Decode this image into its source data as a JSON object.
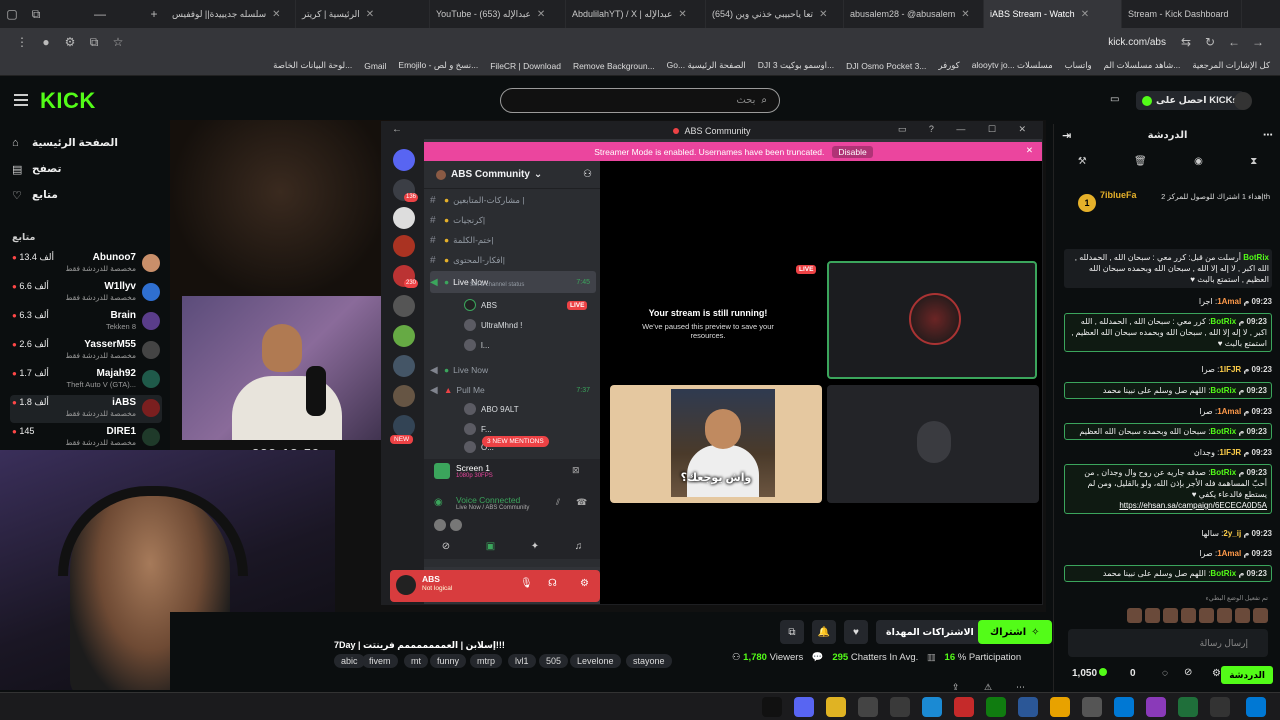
{
  "browser": {
    "tabs": [
      {
        "label": "سلسله جديييدة|| لوففيس"
      },
      {
        "label": "الرئيسية | كريتر"
      },
      {
        "label": "YouTube - عبدالإله (653)"
      },
      {
        "label": "AbdulilahYT) / X | عبدالإله"
      },
      {
        "label": "(654) تعا ياحبيبي خذني وين"
      },
      {
        "label": "abusalem28 - @abusalem"
      },
      {
        "label": "iABS Stream - Watch"
      },
      {
        "label": "Stream - Kick Dashboard"
      }
    ],
    "url": "kick.com/abs",
    "bookmarks": [
      "كل الإشارات المرجعية",
      "شاهد مسلسلات الم...",
      "واتساب",
      "alooytv jo... مسلسلات",
      "كورفر",
      "DJI Osmo Pocket 3...",
      "DJI اوسمو بوكيت 3...",
      "Go... الصفحة الرئيسية",
      "Remove Backgroun...",
      "FileCR | Download",
      "Emojilo - نسخ و لص...",
      "Gmail",
      "لوحة البيانات الخاصة..."
    ]
  },
  "kick": {
    "logo": "KICK",
    "search_placeholder": "بحث",
    "get_kicks": "احصل على KICKs"
  },
  "sidebar": {
    "nav": [
      {
        "label": "الصفحة الرئيسية",
        "icon": "home-icon",
        "glyph": "⌂"
      },
      {
        "label": "تصفح",
        "icon": "browse-icon",
        "glyph": "▤"
      },
      {
        "label": "متابع",
        "icon": "heart-icon",
        "glyph": "♡"
      }
    ],
    "following_title": "متابع",
    "streamers": [
      {
        "name": "Abunoo7",
        "count": "13.4 ألف",
        "category": "مخصصة للدردشة فقط"
      },
      {
        "name": "W1llyv",
        "count": "6.6 ألف",
        "category": "مخصصة للدردشة فقط"
      },
      {
        "name": "Brain",
        "count": "6.3 ألف",
        "category": "Tekken 8"
      },
      {
        "name": "YasserM55",
        "count": "2.6 ألف",
        "category": "مخصصة للدردشة فقط"
      },
      {
        "name": "Majah92",
        "count": "1.7 ألف",
        "category": "Theft Auto V (GTA)..."
      },
      {
        "name": "iABS",
        "count": "1.8 ألف",
        "category": "مخصصة للدردشة فقط"
      },
      {
        "name": "DIRE1",
        "count": "145",
        "category": "مخصصة للدردشة فقط"
      }
    ]
  },
  "stream": {
    "timer": "222:18:59",
    "discord": {
      "window_title": "ABS Community",
      "streamer_mode": "Streamer Mode is enabled. Usernames have been truncated.",
      "disable_label": "Disable",
      "server_name": "ABS Community",
      "channels": [
        {
          "label": "مشاركات-المتابعين |",
          "type": "text"
        },
        {
          "label": "كرنجيات|",
          "type": "text"
        },
        {
          "label": "ختم-الكلمة|",
          "type": "text"
        },
        {
          "label": "افكار-المحتوى|",
          "type": "text"
        }
      ],
      "live_channel": {
        "label": "Live Now",
        "status": "Set a channel status",
        "time": "7:45"
      },
      "voice_users": [
        "ABS",
        "UltraMhnd !",
        "l..."
      ],
      "live_badge": "LIVE",
      "live_now_2": "Live Now",
      "pull_me": {
        "label": "Pull Me",
        "time": "7:37"
      },
      "pull_users": [
        "ABO 9ALT",
        "F...",
        "O..."
      ],
      "new_badge": "NEW",
      "new_mentions": "3 NEW MENTIONS",
      "screen": {
        "title": "Screen 1",
        "sub": "1080p 30FPS"
      },
      "voice_connected": {
        "title": "Voice Connected",
        "sub": "Live Now / ABS Community"
      },
      "user": {
        "name": "ABS",
        "status": "Not logical"
      },
      "running_title": "Your stream is still running!",
      "running_sub": "We've paused this preview to save your resources.",
      "meme_caption": "واش يوجعك؟"
    }
  },
  "info": {
    "title": "7Day | إسلابن | العمممممممم فرينتت!!!",
    "tags": [
      "abic",
      "fivem",
      "mt",
      "funny",
      "mtrp",
      "lvl1",
      "505",
      "Levelone",
      "stayone"
    ],
    "subscribe": "اشتراك",
    "gift": "الاشتراكات المهداة",
    "viewers": "1,780",
    "viewers_label": "Viewers",
    "chatters": "295",
    "chatters_label": "Chatters In Avg.",
    "participation": "16",
    "participation_label": "% Participation"
  },
  "chat": {
    "title": "الدردشة",
    "pinned": {
      "rank": "1",
      "user": "7iblueFa",
      "text": "إهداء 1 اشتراك للوصول للمركز 2th"
    },
    "messages": [
      {
        "time": "",
        "user": "BotRix",
        "cls": "bot",
        "text": "أرسلت من قبل: كرر معي : سبحان الله , الحمدلله , الله اكبر , لا إله إلا الله , سبحان الله وبحمده سبحان الله العظيم , استمتع بالبث ♥",
        "hl": false
      },
      {
        "time": "09:23 م",
        "user": "1Amal",
        "cls": "u1",
        "text": "اجرا",
        "hl": false
      },
      {
        "time": "09:23 م",
        "user": "BotRix",
        "cls": "bot",
        "text": "كرر معي : سبحان الله , الحمدلله , الله اكبر , لا إله إلا الله , سبحان الله وبحمده سبحان الله العظيم , استمتع بالبث ♥",
        "hl": true
      },
      {
        "time": "09:23 م",
        "user": "1IFJR",
        "cls": "u2",
        "text": "صرا",
        "hl": false
      },
      {
        "time": "09:23 م",
        "user": "BotRix",
        "cls": "bot",
        "text": "اللهم صل وسلم على نبينا محمد",
        "hl": true
      },
      {
        "time": "09:23 م",
        "user": "1Amal",
        "cls": "u1",
        "text": "صرا",
        "hl": false
      },
      {
        "time": "09:23 م",
        "user": "BotRix",
        "cls": "bot",
        "text": "سبحان الله وبحمده سبحان الله العظيم",
        "hl": true
      },
      {
        "time": "09:23 م",
        "user": "1IFJR",
        "cls": "u2",
        "text": "وجدان",
        "hl": false
      },
      {
        "time": "09:23 م",
        "user": "BotRix",
        "cls": "bot",
        "text": "صدقه جاريه عن روح وال وجدان , من أحبّ المساهمة فله الأجر بإذن الله، ولو بالقليل، ومن لم يستطع فالدعاء يكفي ♥",
        "link": "https://ehsan.sa/campaign/6ECECA0D5A",
        "hl": true
      },
      {
        "time": "09:23 م",
        "user": "2y_ij",
        "cls": "u2",
        "text": "سالها",
        "hl": false
      },
      {
        "time": "09:23 م",
        "user": "1Amal",
        "cls": "u1",
        "text": "صرا",
        "hl": false
      },
      {
        "time": "09:23 م",
        "user": "BotRix",
        "cls": "bot",
        "text": "اللهم صل وسلم على نبينا محمد",
        "hl": true
      }
    ],
    "slow_mode": "تم تفعيل الوضع البطيء",
    "input_placeholder": "إرسال رسالة",
    "points": "1,050",
    "zero": "0",
    "chat_button": "الدردشة"
  },
  "colors": {
    "kick_green": "#53fc18",
    "discord_pink": "#eb459e",
    "live_red": "#ed4245"
  }
}
